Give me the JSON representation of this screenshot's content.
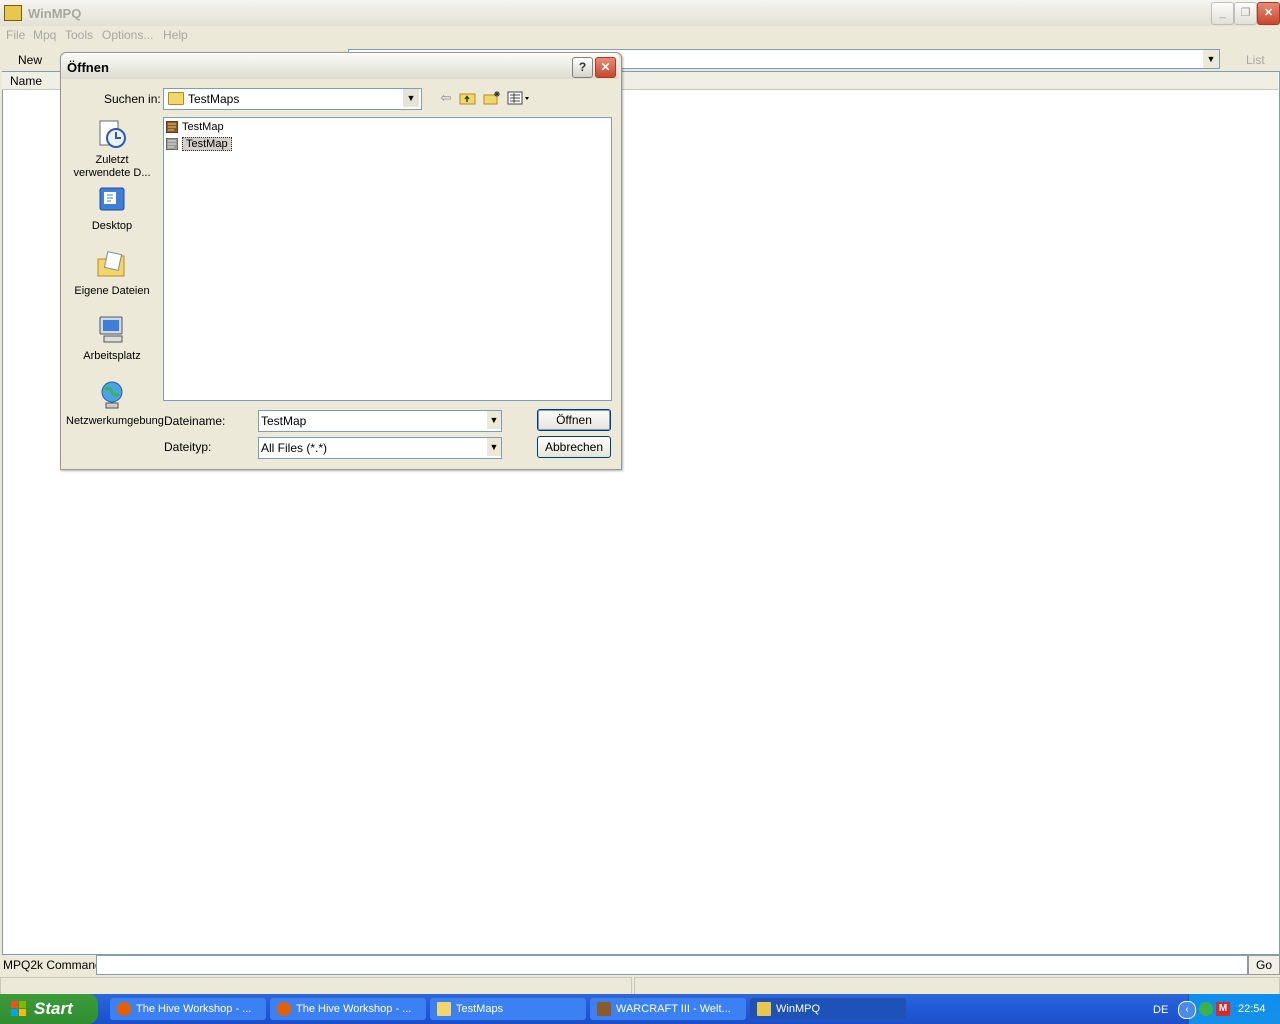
{
  "app": {
    "title": "WinMPQ",
    "menu": [
      "File",
      "Mpq",
      "Tools",
      "Options...",
      "Help"
    ],
    "toolbar": {
      "new_label": "New",
      "list_label": "List"
    },
    "list": {
      "column_name": "Name"
    },
    "command": {
      "label": "MPQ2k Command",
      "go_label": "Go",
      "value": ""
    }
  },
  "dialog": {
    "title": "Öffnen",
    "help_label": "?",
    "lookin_label": "Suchen in:",
    "lookin_value": "TestMaps",
    "places": [
      {
        "label": "Zuletzt verwendete D...",
        "icon": "recent-documents-icon"
      },
      {
        "label": "Desktop",
        "icon": "desktop-icon"
      },
      {
        "label": "Eigene Dateien",
        "icon": "my-documents-icon"
      },
      {
        "label": "Arbeitsplatz",
        "icon": "my-computer-icon"
      },
      {
        "label": "Netzwerkumgebung",
        "icon": "network-icon"
      }
    ],
    "files": [
      {
        "name": "TestMap",
        "icon": "warcraft-map-icon",
        "selected": false
      },
      {
        "name": "TestMap",
        "icon": "warcraft-map-icon",
        "selected": true
      }
    ],
    "filename_label": "Dateiname:",
    "filename_value": "TestMap",
    "filetype_label": "Dateityp:",
    "filetype_value": "All Files (*.*)",
    "open_label": "Öffnen",
    "cancel_label": "Abbrechen"
  },
  "taskbar": {
    "start_label": "Start",
    "tasks": [
      {
        "label": "The Hive Workshop - ...",
        "icon": "firefox-icon"
      },
      {
        "label": "The Hive Workshop - ...",
        "icon": "firefox-icon"
      },
      {
        "label": "TestMaps",
        "icon": "folder-icon"
      },
      {
        "label": "WARCRAFT III - Welt...",
        "icon": "warcraft-icon"
      },
      {
        "label": "WinMPQ",
        "icon": "winmpq-icon"
      }
    ],
    "language": "DE",
    "clock": "22:54"
  }
}
